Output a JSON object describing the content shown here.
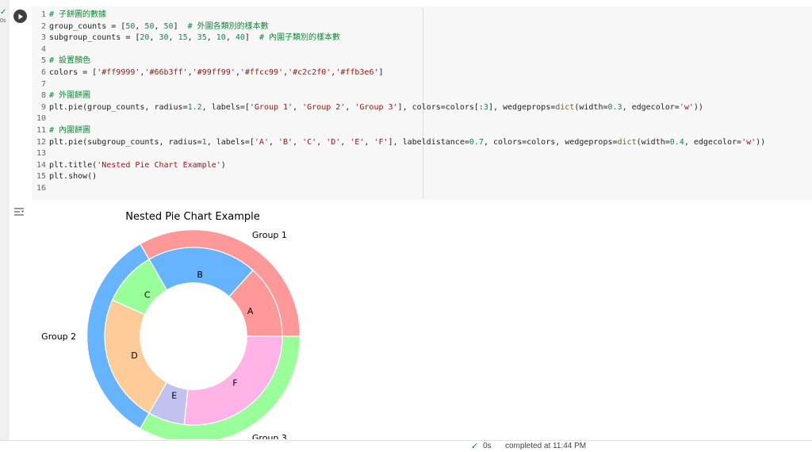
{
  "cell": {
    "exec_mark": "✓",
    "exec_time": "0s",
    "lines": [
      [
        [
          "cm",
          "# 子餅圖的數據"
        ]
      ],
      [
        [
          "",
          "group_counts = ["
        ],
        [
          "nm",
          "50"
        ],
        [
          "",
          ", "
        ],
        [
          "nm",
          "50"
        ],
        [
          "",
          ", "
        ],
        [
          "nm",
          "50"
        ],
        [
          "",
          "]  "
        ],
        [
          "cm",
          "# 外圍各類別的樣本數"
        ]
      ],
      [
        [
          "",
          "subgroup_counts = ["
        ],
        [
          "nm",
          "20"
        ],
        [
          "",
          ", "
        ],
        [
          "nm",
          "30"
        ],
        [
          "",
          ", "
        ],
        [
          "nm",
          "15"
        ],
        [
          "",
          ", "
        ],
        [
          "nm",
          "35"
        ],
        [
          "",
          ", "
        ],
        [
          "nm",
          "10"
        ],
        [
          "",
          ", "
        ],
        [
          "nm",
          "40"
        ],
        [
          "",
          "]  "
        ],
        [
          "cm",
          "# 內圍子類別的樣本數"
        ]
      ],
      [],
      [
        [
          "cm",
          "# 設置顏色"
        ]
      ],
      [
        [
          "",
          "colors = ["
        ],
        [
          "st",
          "'#ff9999'"
        ],
        [
          "",
          ","
        ],
        [
          "st",
          "'#66b3ff'"
        ],
        [
          "",
          ","
        ],
        [
          "st",
          "'#99ff99'"
        ],
        [
          "",
          ","
        ],
        [
          "st",
          "'#ffcc99'"
        ],
        [
          "",
          ","
        ],
        [
          "st",
          "'#c2c2f0'"
        ],
        [
          "",
          ","
        ],
        [
          "st",
          "'#ffb3e6'"
        ],
        [
          "",
          "]"
        ]
      ],
      [],
      [
        [
          "cm",
          "# 外圍餅圖"
        ]
      ],
      [
        [
          "",
          "plt.pie(group_counts, radius="
        ],
        [
          "nm",
          "1.2"
        ],
        [
          "",
          ", labels=["
        ],
        [
          "st",
          "'Group 1'"
        ],
        [
          "",
          ", "
        ],
        [
          "st",
          "'Group 2'"
        ],
        [
          "",
          ", "
        ],
        [
          "st",
          "'Group 3'"
        ],
        [
          "",
          "], colors=colors[:"
        ],
        [
          "nm",
          "3"
        ],
        [
          "",
          "], wedgeprops="
        ],
        [
          "bi",
          "dict"
        ],
        [
          "",
          "(width="
        ],
        [
          "nm",
          "0.3"
        ],
        [
          "",
          ", edgecolor="
        ],
        [
          "st",
          "'w'"
        ],
        [
          "",
          "))"
        ]
      ],
      [],
      [
        [
          "cm",
          "# 內圍餅圖"
        ]
      ],
      [
        [
          "",
          "plt.pie(subgroup_counts, radius="
        ],
        [
          "nm",
          "1"
        ],
        [
          "",
          ", labels=["
        ],
        [
          "st",
          "'A'"
        ],
        [
          "",
          ", "
        ],
        [
          "st",
          "'B'"
        ],
        [
          "",
          ", "
        ],
        [
          "st",
          "'C'"
        ],
        [
          "",
          ", "
        ],
        [
          "st",
          "'D'"
        ],
        [
          "",
          ", "
        ],
        [
          "st",
          "'E'"
        ],
        [
          "",
          ", "
        ],
        [
          "st",
          "'F'"
        ],
        [
          "",
          "], labeldistance="
        ],
        [
          "nm",
          "0.7"
        ],
        [
          "",
          ", colors=colors, wedgeprops="
        ],
        [
          "bi",
          "dict"
        ],
        [
          "",
          "(width="
        ],
        [
          "nm",
          "0.4"
        ],
        [
          "",
          ", edgecolor="
        ],
        [
          "st",
          "'w'"
        ],
        [
          "",
          "))"
        ]
      ],
      [],
      [
        [
          "",
          "plt.title("
        ],
        [
          "st",
          "'Nested Pie Chart Example'"
        ],
        [
          "",
          ")"
        ]
      ],
      [
        [
          "",
          "plt.show()"
        ]
      ],
      []
    ]
  },
  "chart_data": {
    "type": "pie",
    "title": "Nested Pie Chart Example",
    "series": [
      {
        "ring": "outer",
        "radius": 1.2,
        "width": 0.3,
        "labels": [
          "Group 1",
          "Group 2",
          "Group 3"
        ],
        "values": [
          50,
          50,
          50
        ],
        "colors": [
          "#ff9999",
          "#66b3ff",
          "#99ff99"
        ]
      },
      {
        "ring": "inner",
        "radius": 1,
        "width": 0.4,
        "labeldistance": 0.7,
        "labels": [
          "A",
          "B",
          "C",
          "D",
          "E",
          "F"
        ],
        "values": [
          20,
          30,
          15,
          35,
          10,
          40
        ],
        "colors": [
          "#ff9999",
          "#66b3ff",
          "#99ff99",
          "#ffcc99",
          "#c2c2f0",
          "#ffb3e6"
        ]
      }
    ]
  },
  "status": {
    "check": "✓",
    "duration": "0s",
    "text": "completed at 11:44 PM"
  }
}
